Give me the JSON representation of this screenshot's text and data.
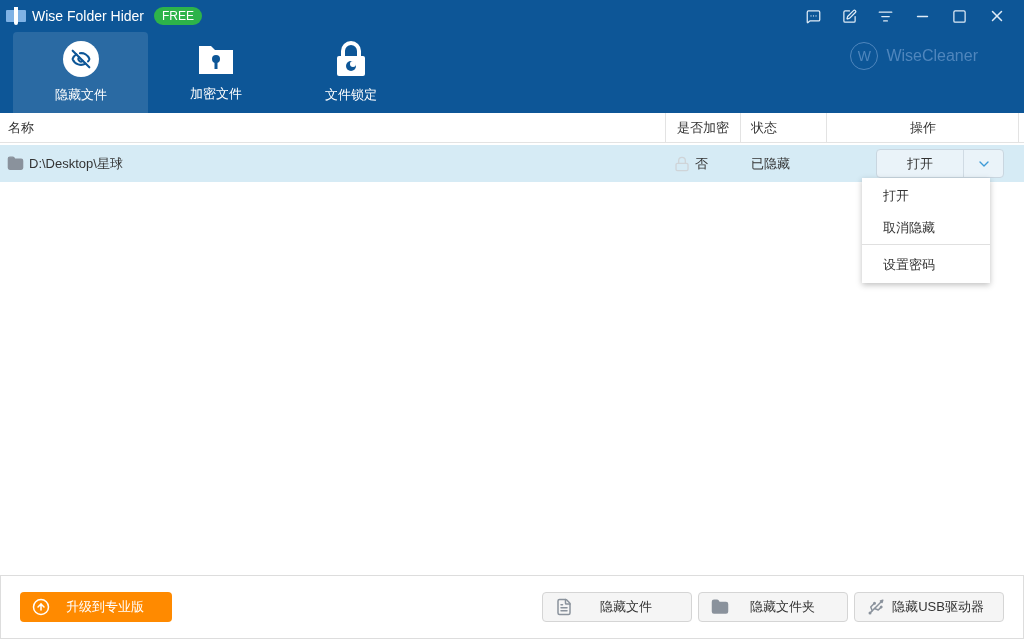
{
  "window": {
    "title": "Wise Folder Hider",
    "badge": "FREE",
    "brand": "WiseCleaner",
    "brand_mark": "W"
  },
  "tabs": [
    {
      "label": "隐藏文件",
      "kind": "eye",
      "selected": true
    },
    {
      "label": "加密文件",
      "kind": "folder",
      "selected": false
    },
    {
      "label": "文件锁定",
      "kind": "lock",
      "selected": false
    }
  ],
  "table": {
    "columns": [
      "名称",
      "是否加密",
      "状态",
      "操作"
    ],
    "rows": [
      {
        "name": "D:\\Desktop\\星球",
        "encrypted": "否",
        "status": "已隐藏",
        "action": "打开",
        "selected": true
      }
    ]
  },
  "menu": [
    {
      "items": [
        "打开",
        "取消隐藏"
      ]
    },
    {
      "items": [
        "设置密码"
      ]
    }
  ],
  "footer": {
    "upgrade": "升级到专业版",
    "buttons": [
      {
        "label": "隐藏文件",
        "kind": "file"
      },
      {
        "label": "隐藏文件夹",
        "kind": "folder"
      },
      {
        "label": "隐藏USB驱动器",
        "kind": "usb"
      }
    ]
  }
}
